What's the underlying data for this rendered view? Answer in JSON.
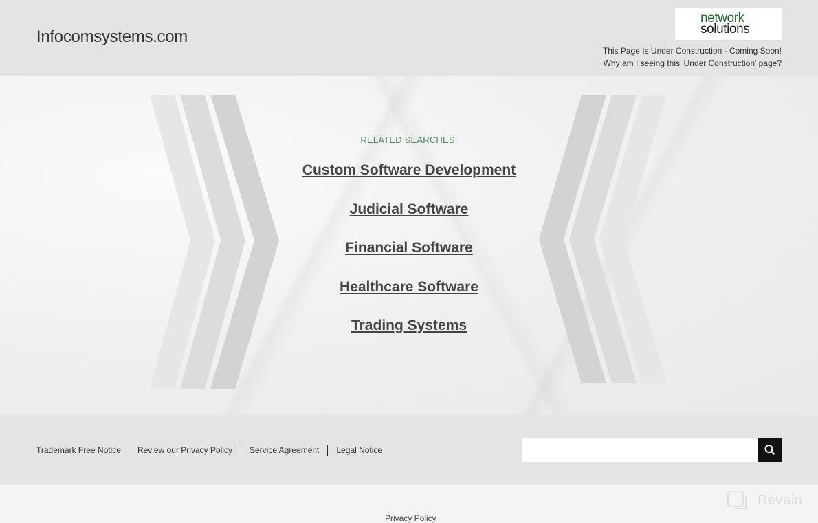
{
  "header": {
    "site_title": "Infocomsystems.com",
    "logo_line1": "network",
    "logo_line2": "solutions",
    "construction_text": "This Page Is Under Construction - Coming Soon!",
    "why_link": "Why am I seeing this 'Under Construction' page?"
  },
  "main": {
    "related_label": "RELATED SEARCHES:",
    "links": [
      "Custom Software Development",
      "Judicial Software",
      "Financial Software",
      "Healthcare Software",
      "Trading Systems"
    ]
  },
  "footer": {
    "links": [
      "Trademark Free Notice",
      "Review our Privacy Policy",
      "Service Agreement",
      "Legal Notice"
    ],
    "search_placeholder": "",
    "search_icon": "search-icon"
  },
  "bottom": {
    "privacy_peek": "Privacy Policy",
    "watermark_text": "Revain"
  },
  "colors": {
    "header_bg": "#e4e4e4",
    "related_label": "#3f8a4f",
    "link": "#444444",
    "search_button": "#111111"
  }
}
